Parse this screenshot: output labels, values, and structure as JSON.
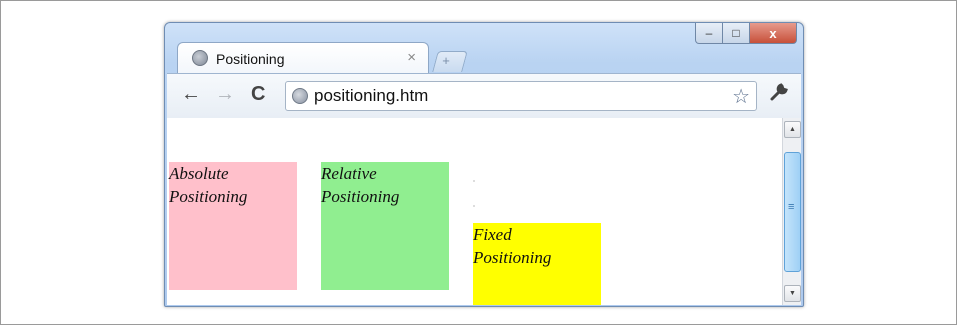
{
  "browser": {
    "tab_title": "Positioning",
    "tab_close": "×",
    "new_tab": "+",
    "address": "positioning.htm",
    "window_controls": {
      "minimize": "–",
      "maximize": "□",
      "close": "x"
    },
    "nav": {
      "back": "←",
      "forward": "→",
      "reload": "C"
    },
    "star": "☆",
    "wrench": "🔧"
  },
  "page": {
    "absolute_box": {
      "line1": "Absolute",
      "line2": "Positioning",
      "color": "#ffc0cb"
    },
    "relative_box": {
      "line1": "Relative",
      "line2": "Positioning",
      "color": "#90ee90"
    },
    "fixed_box": {
      "line1": "Fixed",
      "line2": "Positioning",
      "color": "#ffff00"
    }
  },
  "icons": [
    "globe-icon",
    "close-icon",
    "new-tab-icon",
    "back-icon",
    "forward-icon",
    "reload-icon",
    "star-icon",
    "wrench-icon",
    "scroll-up-icon",
    "scroll-down-icon"
  ]
}
